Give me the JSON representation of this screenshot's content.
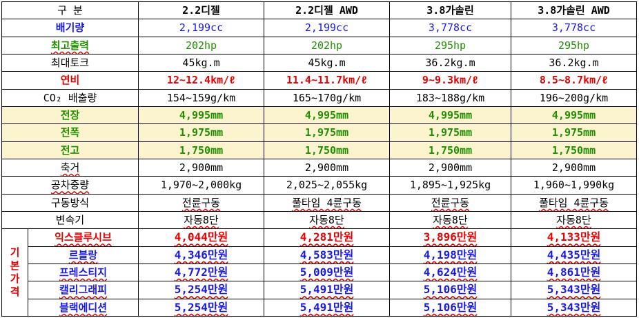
{
  "header": {
    "label": "구 분",
    "columns": [
      "2.2디젤",
      "2.2디젤 AWD",
      "3.8가솔린",
      "3.8가솔린 AWD"
    ]
  },
  "rows": [
    {
      "label": "배기량",
      "values": [
        "2,199cc",
        "2,199cc",
        "3,778cc",
        "3,778cc"
      ]
    },
    {
      "label": "최고출력",
      "values": [
        "202hp",
        "202hp",
        "295hp",
        "295hp"
      ]
    },
    {
      "label": "최대토크",
      "values": [
        "45kg.m",
        "45kg.m",
        "36.2kg.m",
        "36.2kg.m"
      ]
    },
    {
      "label": "연비",
      "values": [
        "12~12.4km/ℓ",
        "11.4~11.7km/ℓ",
        "9~9.3km/ℓ",
        "8.5~8.7km/ℓ"
      ]
    },
    {
      "label": "CO₂ 배출량",
      "values": [
        "154~159g/km",
        "165~170g/km",
        "183~188g/km",
        "196~200g/km"
      ]
    },
    {
      "label": "전장",
      "values": [
        "4,995mm",
        "4,995mm",
        "4,995mm",
        "4,995mm"
      ]
    },
    {
      "label": "전폭",
      "values": [
        "1,975mm",
        "1,975mm",
        "1,975mm",
        "1,975mm"
      ]
    },
    {
      "label": "전고",
      "values": [
        "1,750mm",
        "1,750mm",
        "1,750mm",
        "1,750mm"
      ]
    },
    {
      "label": "축거",
      "values": [
        "2,900mm",
        "2,900mm",
        "2,900mm",
        "2,900mm"
      ]
    },
    {
      "label": "공차중량",
      "values": [
        "1,970~2,000kg",
        "2,025~2,055kg",
        "1,895~1,925kg",
        "1,960~1,990kg"
      ]
    },
    {
      "label": "구동방식",
      "values": [
        "전륜구동",
        "풀타임 4륜구동",
        "전륜구동",
        "풀타임 4륜구동"
      ]
    },
    {
      "label": "변속기",
      "values": [
        "자동8단",
        "자동8단",
        "자동8단",
        "자동8단"
      ]
    }
  ],
  "price_group": {
    "label": [
      "기",
      "본",
      "가",
      "격"
    ],
    "rows": [
      {
        "label": "익스클루시브",
        "values": [
          "4,044만원",
          "4,281만원",
          "3,896만원",
          "4,133만원"
        ]
      },
      {
        "label": "르블랑",
        "values": [
          "4,346만원",
          "4,583만원",
          "4,198만원",
          "4,435만원"
        ]
      },
      {
        "label": "프레스티지",
        "values": [
          "4,772만원",
          "5,009만원",
          "4,624만원",
          "4,861만원"
        ]
      },
      {
        "label": "캘리그래피",
        "values": [
          "5,254만원",
          "5,491만원",
          "5,106만원",
          "5,343만원"
        ]
      },
      {
        "label": "블랙에디션",
        "values": [
          "5,254만원",
          "5,491만원",
          "5,106만원",
          "5,343만원"
        ]
      }
    ]
  },
  "colors": {
    "blue": "#1a1ae6",
    "green": "#1f8f00",
    "red": "#e60000",
    "highlight": "#fbf4cf"
  }
}
